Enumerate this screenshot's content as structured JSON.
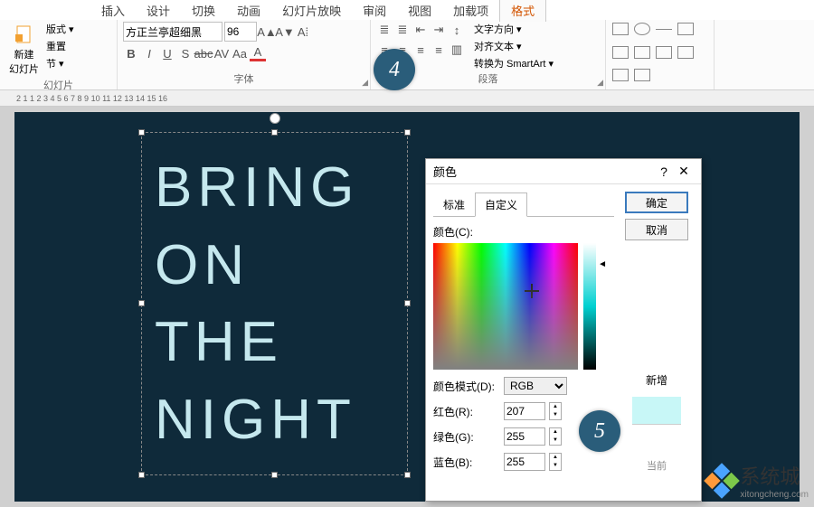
{
  "menu": {
    "tabs": [
      "插入",
      "设计",
      "切换",
      "动画",
      "幻灯片放映",
      "审阅",
      "视图",
      "加载项",
      "格式"
    ],
    "active": "格式"
  },
  "ribbon": {
    "slides": {
      "new_slide": "新建\n幻灯片",
      "layout": "版式 ▾",
      "reset": "重置",
      "section": "节 ▾",
      "label": "幻灯片"
    },
    "font": {
      "name": "方正兰亭超细黑",
      "size": "96",
      "b": "B",
      "i": "I",
      "u": "U",
      "s": "S",
      "abc": "abc",
      "av": "AV",
      "aa": "Aa",
      "a_color": "A",
      "label": "字体"
    },
    "paragraph": {
      "text_dir": "文字方向 ▾",
      "align_text": "对齐文本 ▾",
      "smartart": "转换为 SmartArt ▾",
      "label": "段落"
    },
    "shapes": {
      "label": ""
    }
  },
  "ruler": "  2   1     1   2   3   4   5   6   7   8   9   10   11   12   13   14   15   16",
  "slide": {
    "text": "BRING\nON\nTHE\nNIGHT"
  },
  "callouts": {
    "four": "4",
    "five": "5"
  },
  "dialog": {
    "title": "颜色",
    "help": "?",
    "close": "✕",
    "tabs": {
      "standard": "标准",
      "custom": "自定义"
    },
    "color_label": "颜色(C):",
    "model_label": "颜色模式(D):",
    "model_value": "RGB",
    "r_label": "红色(R):",
    "r_value": "207",
    "g_label": "绿色(G):",
    "g_value": "255",
    "b_label": "蓝色(B):",
    "b_value": "255",
    "ok": "确定",
    "cancel": "取消",
    "new_label": "新增",
    "current_label": "当前"
  },
  "watermark": {
    "text": "系统城",
    "url": "xitongcheng.com"
  }
}
